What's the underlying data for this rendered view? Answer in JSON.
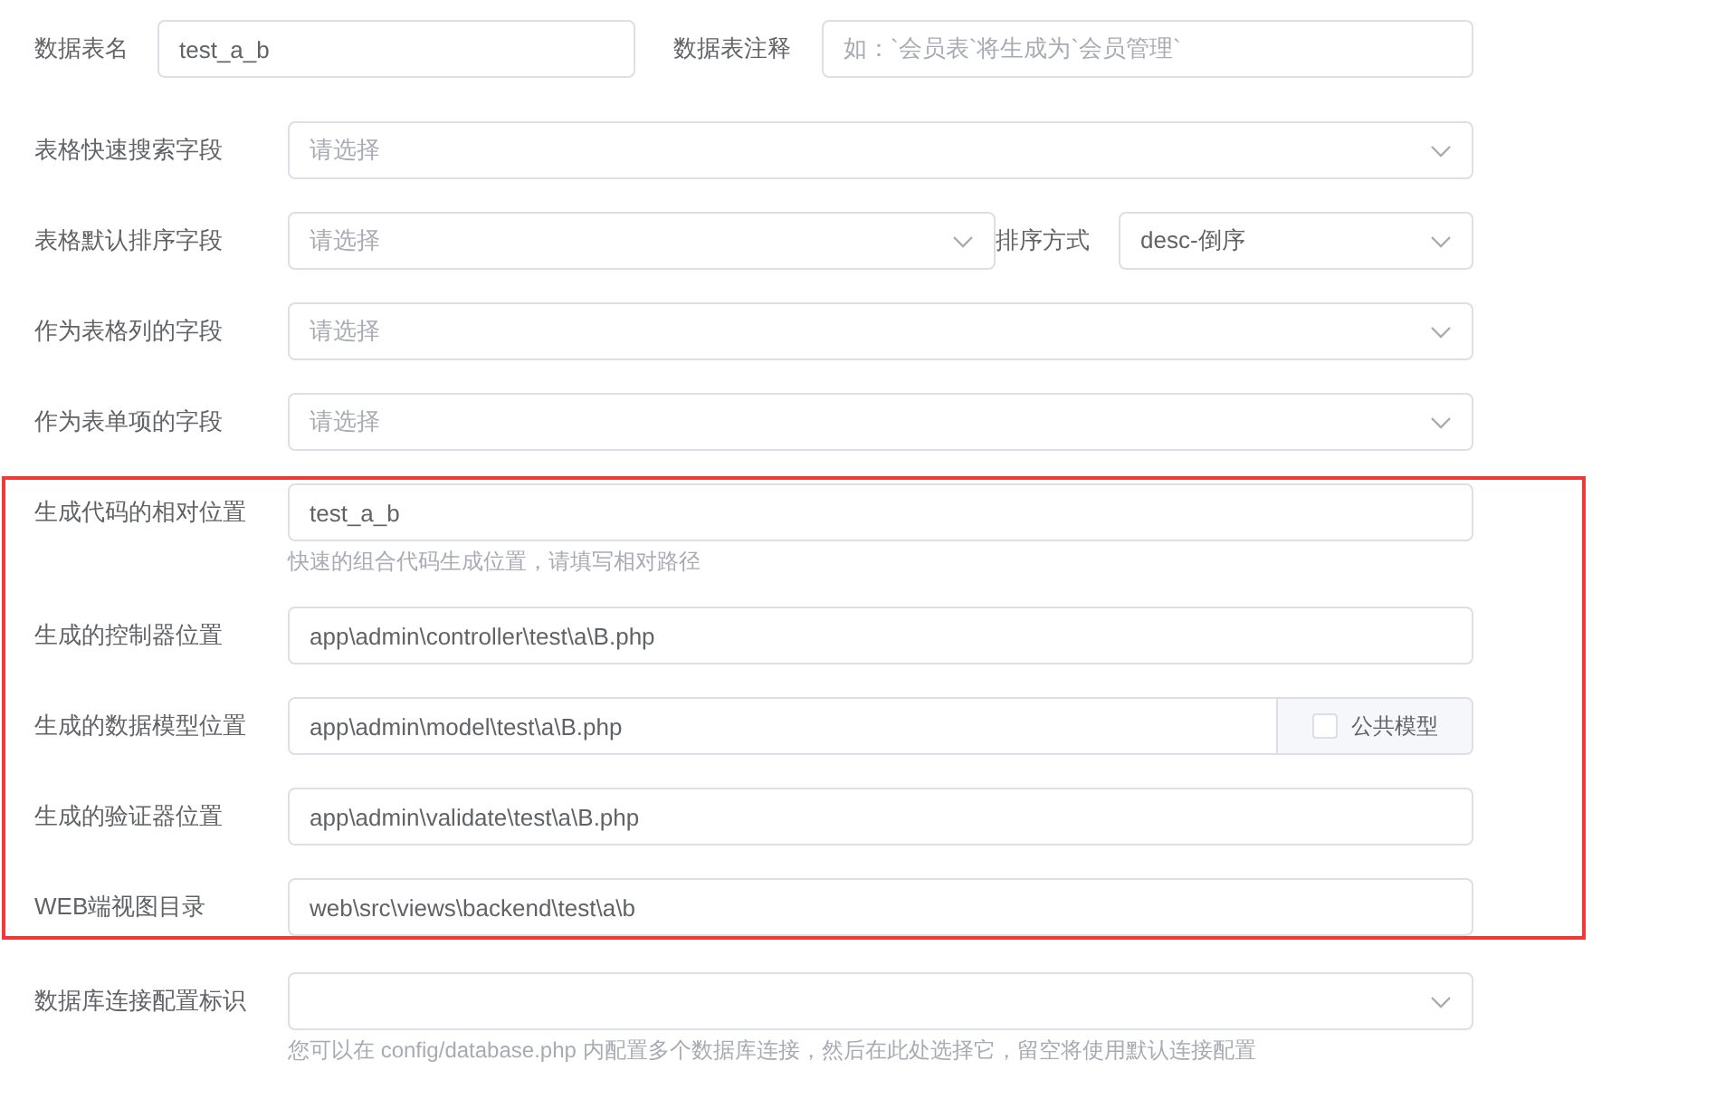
{
  "groups": [
    {
      "highlighted": false,
      "rows": [
        {
          "kind": "pair",
          "items": [
            {
              "label": "数据表名",
              "value": "test_a_b"
            },
            {
              "label": "数据表注释",
              "placeholder": "如：`会员表`将生成为`会员管理`"
            }
          ]
        },
        {
          "kind": "select",
          "label": "表格快速搜索字段",
          "placeholder": "请选择"
        },
        {
          "kind": "select_sort",
          "label": "表格默认排序字段",
          "placeholder": "请选择",
          "sort_label": "排序方式",
          "sort_value": "desc-倒序"
        },
        {
          "kind": "select",
          "label": "作为表格列的字段",
          "placeholder": "请选择"
        },
        {
          "kind": "select",
          "label": "作为表单项的字段",
          "placeholder": "请选择"
        }
      ]
    },
    {
      "highlighted": true,
      "rows": [
        {
          "kind": "text",
          "label": "生成代码的相对位置",
          "value": "test_a_b",
          "hint": "快速的组合代码生成位置，请填写相对路径"
        },
        {
          "kind": "text",
          "label": "生成的控制器位置",
          "value": "app\\admin\\controller\\test\\a\\B.php"
        },
        {
          "kind": "text_addon",
          "label": "生成的数据模型位置",
          "value": "app\\admin\\model\\test\\a\\B.php",
          "addon": {
            "label": "公共模型",
            "checked": false
          }
        },
        {
          "kind": "text",
          "label": "生成的验证器位置",
          "value": "app\\admin\\validate\\test\\a\\B.php"
        },
        {
          "kind": "text",
          "label": "WEB端视图目录",
          "value": "web\\src\\views\\backend\\test\\a\\b"
        }
      ]
    },
    {
      "highlighted": false,
      "rows": [
        {
          "kind": "select",
          "label": "数据库连接配置标识",
          "hint": "您可以在 config/database.php 内配置多个数据库连接，然后在此处选择它，留空将使用默认连接配置"
        }
      ]
    }
  ]
}
